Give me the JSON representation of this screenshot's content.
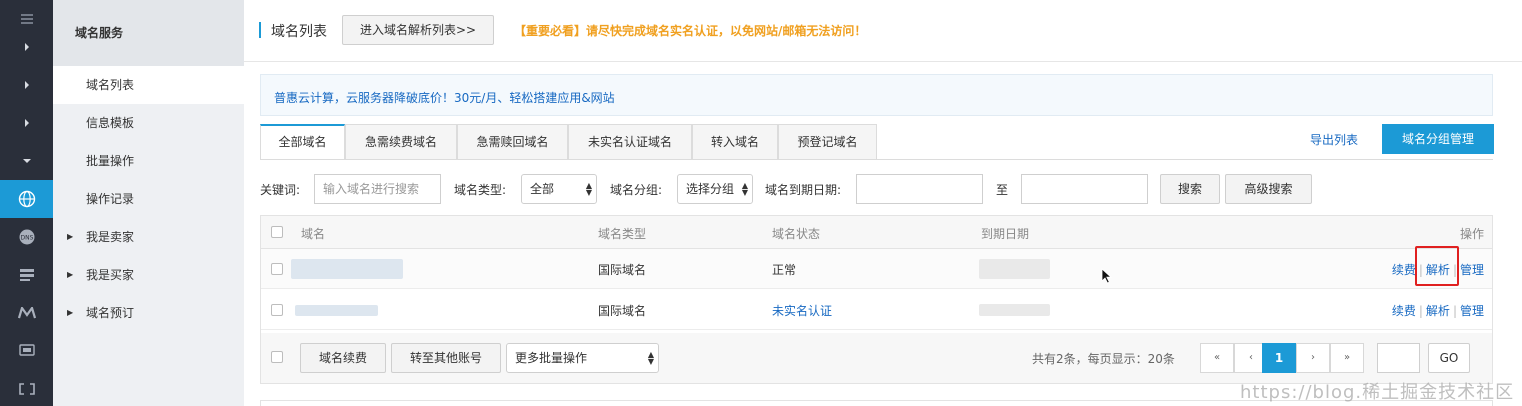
{
  "rail": {
    "items": [
      {
        "icon": "menu-icon"
      },
      {
        "icon": "caret-right-icon"
      },
      {
        "icon": "caret-right-icon"
      },
      {
        "icon": "caret-right-icon"
      },
      {
        "icon": "caret-down-icon"
      },
      {
        "icon": "globe-icon",
        "active": true
      },
      {
        "icon": "dns-icon"
      },
      {
        "icon": "server-stack-icon"
      },
      {
        "icon": "m-logo-icon"
      },
      {
        "icon": "monitor-icon"
      },
      {
        "icon": "bracket-icon"
      }
    ]
  },
  "sidebar": {
    "title": "域名服务",
    "items": [
      {
        "label": "域名列表",
        "active": true
      },
      {
        "label": "信息模板"
      },
      {
        "label": "批量操作"
      },
      {
        "label": "操作记录"
      },
      {
        "label": "我是卖家",
        "expandable": true
      },
      {
        "label": "我是买家",
        "expandable": true
      },
      {
        "label": "域名预订",
        "expandable": true
      }
    ]
  },
  "header": {
    "title": "域名列表",
    "dns_list_button": "进入域名解析列表>>",
    "notice": "【重要必看】请尽快完成域名实名认证，以免网站/邮箱无法访问！"
  },
  "promo": {
    "text": "普惠云计算，云服务器降破底价！30元/月、轻松搭建应用&网站"
  },
  "tabs": [
    {
      "label": "全部域名",
      "active": true
    },
    {
      "label": "急需续费域名"
    },
    {
      "label": "急需赎回域名"
    },
    {
      "label": "未实名认证域名"
    },
    {
      "label": "转入域名"
    },
    {
      "label": "预登记域名"
    }
  ],
  "actions": {
    "export": "导出列表",
    "group_manage": "域名分组管理"
  },
  "filters": {
    "keyword_label": "关键词:",
    "keyword_placeholder": "输入域名进行搜索",
    "type_label": "域名类型:",
    "type_value": "全部",
    "group_label": "域名分组:",
    "group_value": "选择分组",
    "expiry_label": "域名到期日期:",
    "to_label": "至",
    "search_button": "搜索",
    "advanced_button": "高级搜索"
  },
  "table": {
    "headers": {
      "domain": "域名",
      "type": "域名类型",
      "status": "域名状态",
      "expiry": "到期日期",
      "ops": "操作"
    },
    "rows": [
      {
        "type": "国际域名",
        "status": "正常",
        "status_link": false
      },
      {
        "type": "国际域名",
        "status": "未实名认证",
        "status_link": true
      }
    ],
    "ops": {
      "renew": "续费",
      "resolve": "解析",
      "manage": "管理"
    }
  },
  "footer": {
    "renew_button": "域名续费",
    "transfer_button": "转至其他账号",
    "more_select": "更多批量操作",
    "summary": "共有2条，每页显示：20条",
    "pager": {
      "first": "«",
      "prev": "‹",
      "current": "1",
      "next": "›",
      "last": "»"
    },
    "go_button": "GO"
  },
  "watermark": "https://blog.稀土掘金技术社区"
}
